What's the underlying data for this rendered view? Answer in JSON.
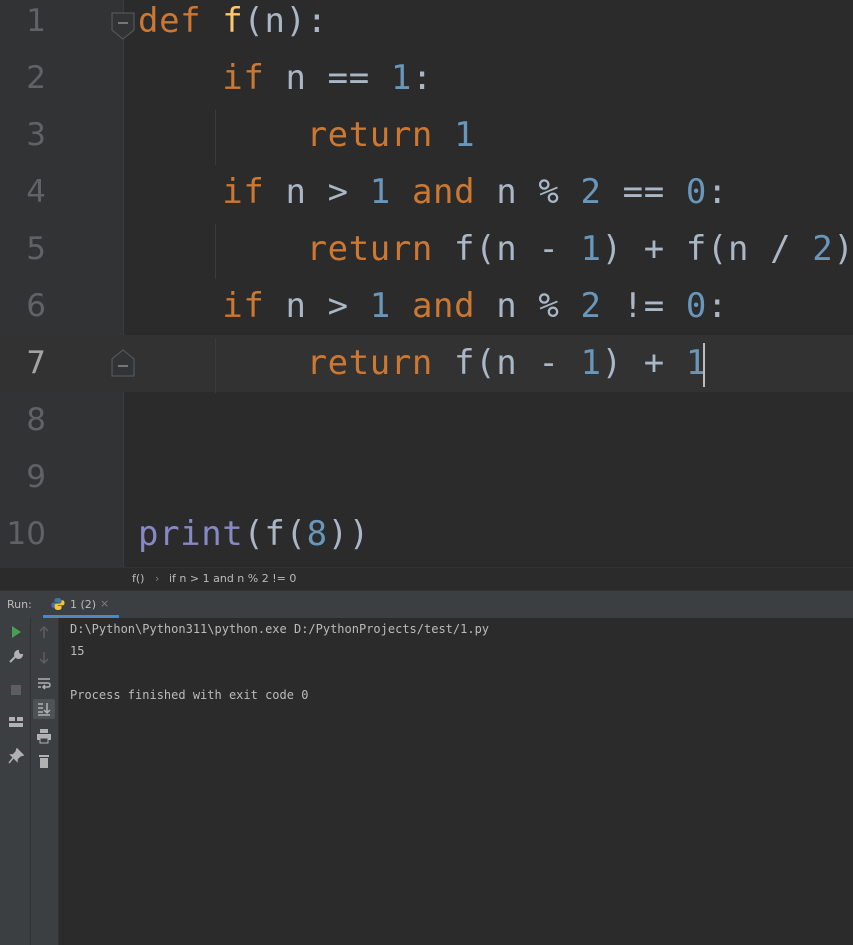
{
  "editor": {
    "line_numbers": [
      "1",
      "2",
      "3",
      "4",
      "5",
      "6",
      "7",
      "8",
      "9",
      "10"
    ],
    "current_line": "7",
    "code_lines": [
      [
        {
          "t": "def",
          "c": "kw"
        },
        {
          "t": " "
        },
        {
          "t": "f",
          "c": "fn"
        },
        {
          "t": "(n):"
        }
      ],
      [
        {
          "t": "    "
        },
        {
          "t": "if",
          "c": "kw"
        },
        {
          "t": " n == "
        },
        {
          "t": "1",
          "c": "num"
        },
        {
          "t": ":"
        }
      ],
      [
        {
          "t": "        "
        },
        {
          "t": "return",
          "c": "kw"
        },
        {
          "t": " "
        },
        {
          "t": "1",
          "c": "num"
        }
      ],
      [
        {
          "t": "    "
        },
        {
          "t": "if",
          "c": "kw"
        },
        {
          "t": " n > "
        },
        {
          "t": "1",
          "c": "num"
        },
        {
          "t": " "
        },
        {
          "t": "and",
          "c": "kw"
        },
        {
          "t": " n % "
        },
        {
          "t": "2",
          "c": "num"
        },
        {
          "t": " == "
        },
        {
          "t": "0",
          "c": "num"
        },
        {
          "t": ":"
        }
      ],
      [
        {
          "t": "        "
        },
        {
          "t": "return",
          "c": "kw"
        },
        {
          "t": " f(n - "
        },
        {
          "t": "1",
          "c": "num"
        },
        {
          "t": ") + f(n / "
        },
        {
          "t": "2",
          "c": "num"
        },
        {
          "t": ")"
        }
      ],
      [
        {
          "t": "    "
        },
        {
          "t": "if",
          "c": "kw"
        },
        {
          "t": " n > "
        },
        {
          "t": "1",
          "c": "num"
        },
        {
          "t": " "
        },
        {
          "t": "and",
          "c": "kw"
        },
        {
          "t": " n % "
        },
        {
          "t": "2",
          "c": "num"
        },
        {
          "t": " != "
        },
        {
          "t": "0",
          "c": "num"
        },
        {
          "t": ":"
        }
      ],
      [
        {
          "t": "        "
        },
        {
          "t": "return",
          "c": "kw"
        },
        {
          "t": " f(n - "
        },
        {
          "t": "1",
          "c": "num"
        },
        {
          "t": ") + "
        },
        {
          "t": "1",
          "c": "num"
        }
      ],
      [],
      [],
      [
        {
          "t": "print",
          "c": "builtin"
        },
        {
          "t": "(f("
        },
        {
          "t": "8",
          "c": "num"
        },
        {
          "t": "))"
        }
      ]
    ]
  },
  "breadcrumb": {
    "items": [
      "f()",
      "if n > 1 and n % 2 != 0"
    ],
    "separator": "›"
  },
  "run_panel": {
    "label": "Run:",
    "tab_label": "1 (2)",
    "tab_close": "×",
    "output_lines": [
      "D:\\Python\\Python311\\python.exe D:/PythonProjects/test/1.py",
      "15",
      "",
      "Process finished with exit code 0"
    ]
  },
  "colors": {
    "keyword": "#cc7832",
    "number": "#6897bb",
    "function": "#ffc66d",
    "builtin": "#8888c6",
    "default_text": "#a9b7c6",
    "background": "#2b2b2b",
    "run_green": "#499c54",
    "tab_underline": "#4a88c7"
  },
  "icons": {
    "left_toolbar": [
      "run-icon",
      "wrench-icon",
      "stop-icon",
      "layout-icon",
      "pin-icon"
    ],
    "second_toolbar": [
      "arrow-up-icon",
      "arrow-down-icon",
      "soft-wrap-icon",
      "scroll-to-end-icon",
      "print-icon",
      "trash-icon"
    ]
  }
}
